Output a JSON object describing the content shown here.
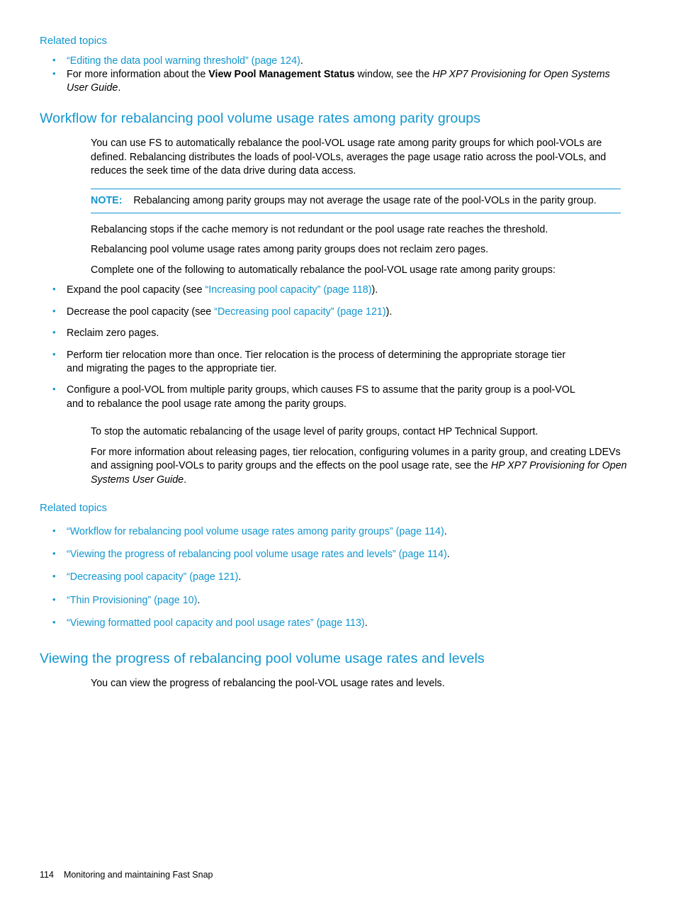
{
  "page": {
    "number": "114",
    "footer_text": "Monitoring and maintaining Fast Snap"
  },
  "related_topics_1": {
    "heading": "Related topics",
    "items": [
      {
        "link": "“Editing the data pool warning threshold” (page 124)",
        "after": "."
      }
    ],
    "item2": {
      "pre": "For more information about the ",
      "bold": "View Pool Management Status",
      "mid": " window, see the ",
      "italic": "HP XP7 Provisioning for Open Systems User Guide",
      "post": "."
    }
  },
  "section1": {
    "heading": "Workflow for rebalancing pool volume usage rates among parity groups",
    "intro": "You can use FS to automatically rebalance the pool-VOL usage rate among parity groups for which pool-VOLs are defined. Rebalancing distributes the loads of pool-VOLs, averages the page usage ratio across the pool-VOLs, and reduces the seek time of the data drive during data access.",
    "note_label": "NOTE:",
    "note_text": "Rebalancing among parity groups may not average the usage rate of the pool-VOLs in the parity group.",
    "para2": "Rebalancing stops if the cache memory is not redundant or the pool usage rate reaches the threshold.",
    "para3": "Rebalancing pool volume usage rates among parity groups does not reclaim zero pages.",
    "para4": "Complete one of the following to automatically rebalance the pool-VOL usage rate among parity groups:",
    "bullets": [
      {
        "pre": "Expand the pool capacity (see ",
        "link": "“Increasing pool capacity” (page 118)",
        "post": ")."
      },
      {
        "pre": "Decrease the pool capacity (see ",
        "link": "“Decreasing pool capacity” (page 121)",
        "post": ")."
      },
      {
        "pre": "Reclaim zero pages.",
        "link": "",
        "post": ""
      },
      {
        "pre": "Perform tier relocation more than once. Tier relocation is the process of determining the appropriate storage tier and migrating the pages to the appropriate tier.",
        "link": "",
        "post": ""
      },
      {
        "pre": "Configure a pool-VOL from multiple parity groups, which causes FS to assume that the parity group is a pool-VOL and to rebalance the pool usage rate among the parity groups.",
        "link": "",
        "post": ""
      }
    ],
    "para5": "To stop the automatic rebalancing of the usage level of parity groups, contact HP Technical Support.",
    "para6_pre": "For more information about releasing pages, tier relocation, configuring volumes in a parity group, and creating LDEVs and assigning pool-VOLs to parity groups and the effects on the pool usage rate, see the ",
    "para6_italic": "HP XP7 Provisioning for Open Systems User Guide",
    "para6_post": "."
  },
  "related_topics_2": {
    "heading": "Related topics",
    "items": [
      {
        "link": "“Workflow for rebalancing pool volume usage rates among parity groups” (page 114)",
        "after": "."
      },
      {
        "link": "“Viewing the progress of rebalancing pool volume usage rates and levels” (page 114)",
        "after": "."
      },
      {
        "link": "“Decreasing pool capacity” (page 121)",
        "after": "."
      },
      {
        "link": "“Thin Provisioning” (page 10)",
        "after": "."
      },
      {
        "link": "“Viewing formatted pool capacity and pool usage rates” (page 113)",
        "after": "."
      }
    ]
  },
  "section2": {
    "heading": "Viewing the progress of rebalancing pool volume usage rates and levels",
    "intro": "You can view the progress of rebalancing the pool-VOL usage rates and levels."
  },
  "colors": {
    "accent": "#1296cf",
    "text": "#000000"
  }
}
